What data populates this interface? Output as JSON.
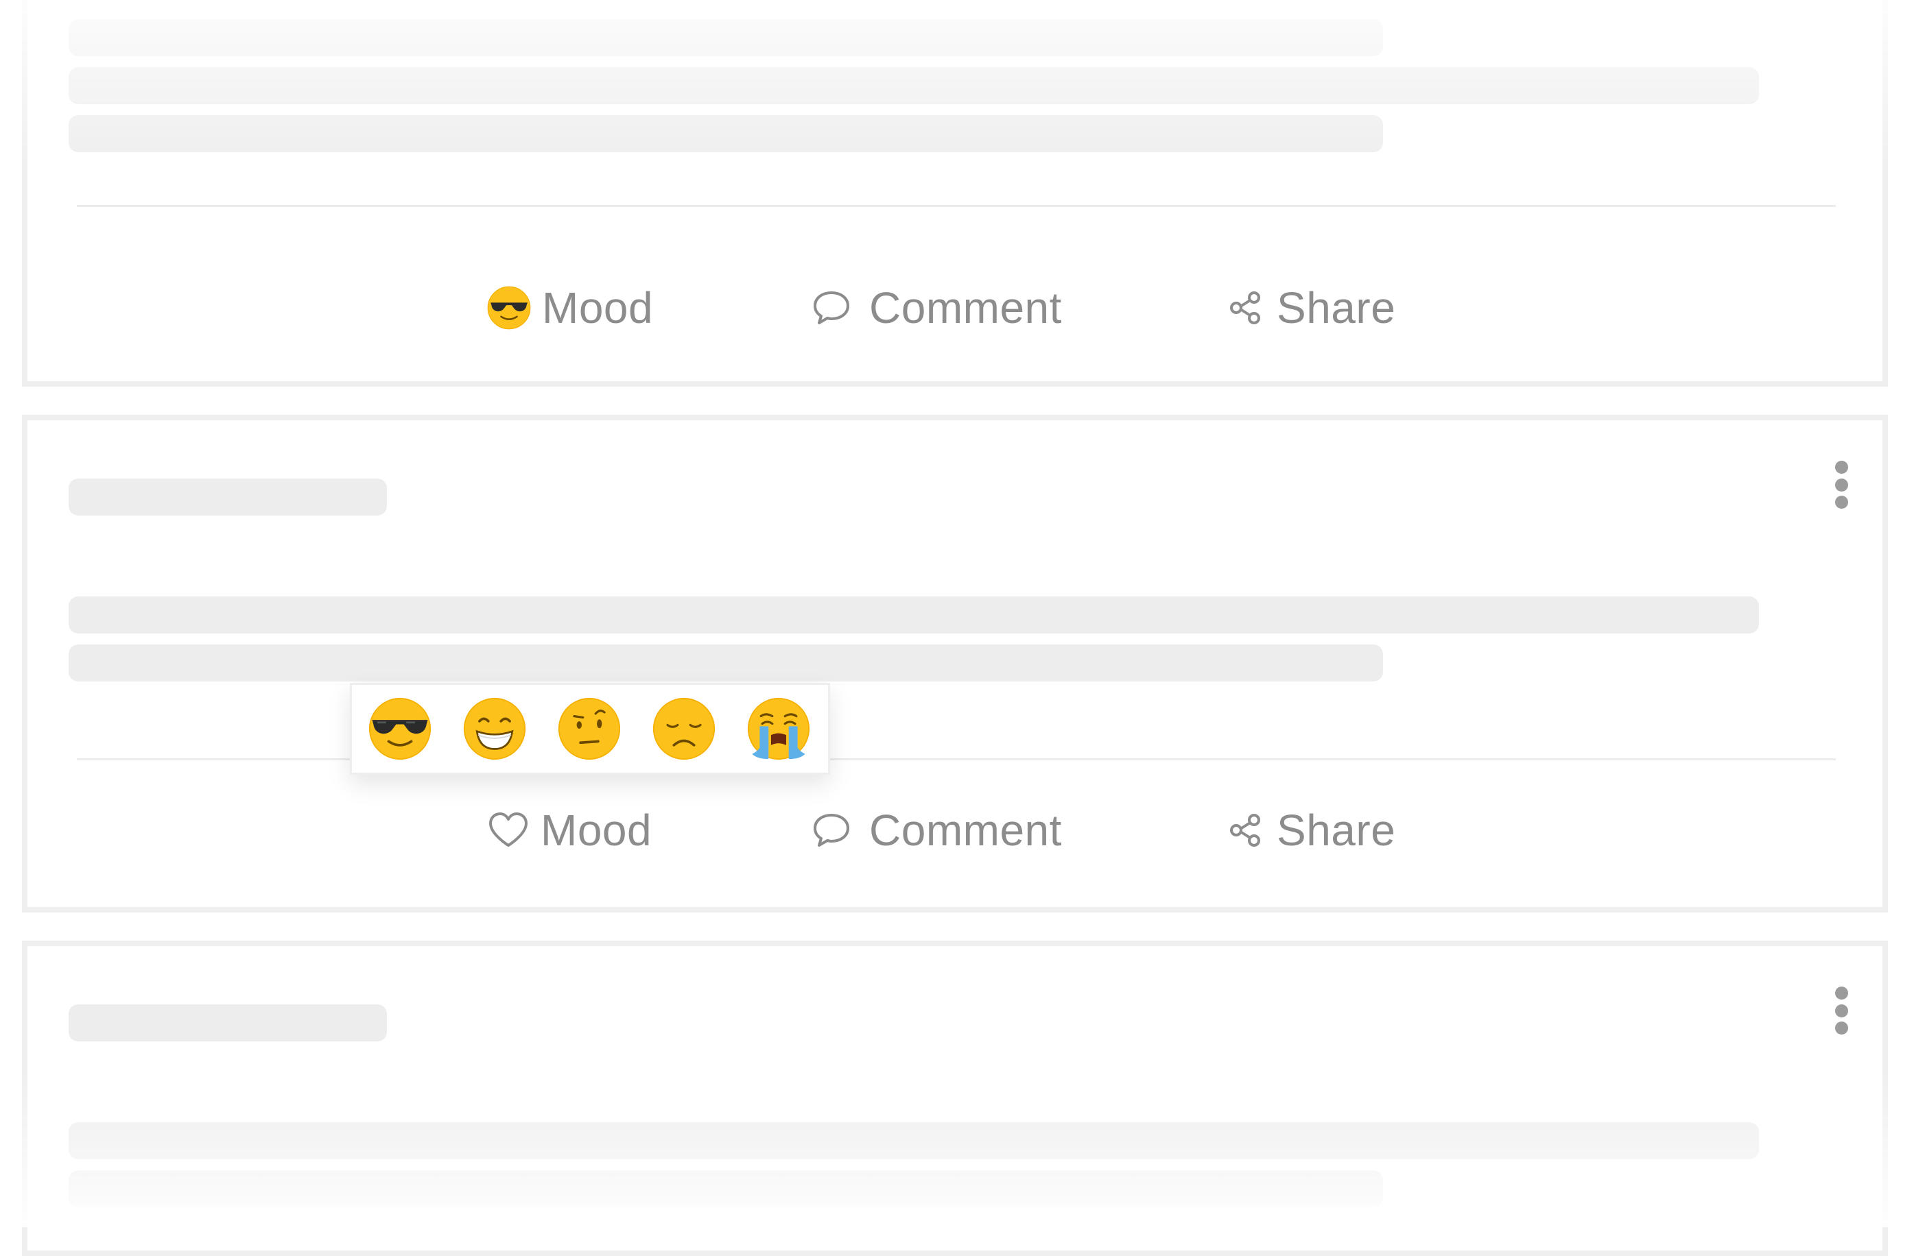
{
  "post_actions": {
    "mood_label": "Mood",
    "comment_label": "Comment",
    "share_label": "Share"
  },
  "cards": [
    {
      "mood_icon": "sunglasses-emoji-icon",
      "mood_selected": true,
      "options_icon": "more-vertical-icon"
    },
    {
      "mood_icon": "heart-outline-icon",
      "mood_selected": false,
      "options_icon": "more-vertical-icon"
    },
    {
      "mood_icon": "heart-outline-icon",
      "mood_selected": false,
      "options_icon": "more-vertical-icon"
    }
  ],
  "mood_picker": {
    "options": [
      {
        "name": "cool",
        "icon": "sunglasses-emoji-icon"
      },
      {
        "name": "happy",
        "icon": "grinning-emoji-icon"
      },
      {
        "name": "skeptical",
        "icon": "raised-eyebrow-emoji-icon"
      },
      {
        "name": "sad",
        "icon": "frowning-emoji-icon"
      },
      {
        "name": "crying",
        "icon": "loudly-crying-emoji-icon"
      }
    ]
  },
  "colors": {
    "skeleton": "#ededed",
    "card_border": "#efefef",
    "action_text": "#8c8c8c",
    "emoji_yellow": "#fcc21b",
    "tears_blue": "#5eb0e8"
  }
}
